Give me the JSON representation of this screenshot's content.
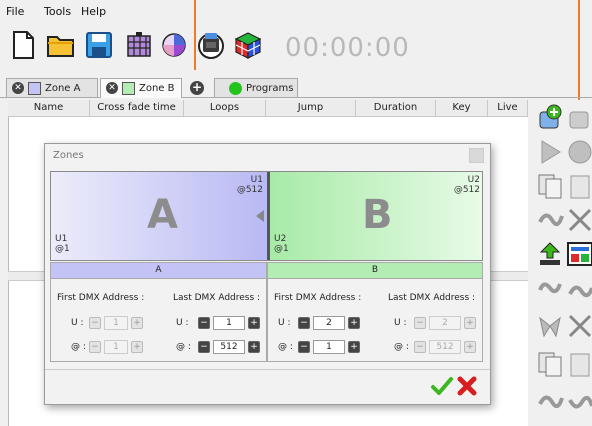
{
  "menu": {
    "file": "File",
    "tools": "Tools",
    "help": "Help"
  },
  "toolbar": {
    "timer": "00:00:00",
    "icons": [
      "new-file-icon",
      "open-folder-icon",
      "save-icon",
      "grid-icon",
      "color-wheel-icon",
      "dmx-device-icon",
      "rgb-cube-icon"
    ]
  },
  "tabs": [
    {
      "label": "Zone A",
      "swatch": "#c3c3f5"
    },
    {
      "label": "Zone B",
      "swatch": "#b4edb4"
    },
    {
      "label": "Programs",
      "dot": "#22c51e"
    }
  ],
  "table": {
    "columns": [
      "Name",
      "Cross fade time",
      "Loops",
      "Jump",
      "Duration",
      "Key",
      "Live"
    ]
  },
  "dialog": {
    "title": "Zones",
    "zone_a": {
      "letter": "A",
      "top_label": "U1\n@512",
      "bottom_label": "U1\n@1",
      "header": "A"
    },
    "zone_b": {
      "letter": "B",
      "top_label": "U2\n@512",
      "bottom_label": "U2\n@1",
      "header": "B"
    },
    "first_label": "First DMX Address :",
    "last_label": "Last DMX Address :",
    "u_label": "U :",
    "at_label": "@ :",
    "a_first_u": "1",
    "a_first_at": "1",
    "a_last_u": "1",
    "a_last_at": "512",
    "b_first_u": "2",
    "b_first_at": "1",
    "b_last_u": "2",
    "b_last_at": "512",
    "minus": "−",
    "plus": "+"
  },
  "colors": {
    "accent_orange": "#f07a22",
    "zone_a": "#b9b9f4",
    "zone_b": "#a8eaa8",
    "ok_green": "#3cb71e",
    "cancel_red": "#d81e1e"
  }
}
